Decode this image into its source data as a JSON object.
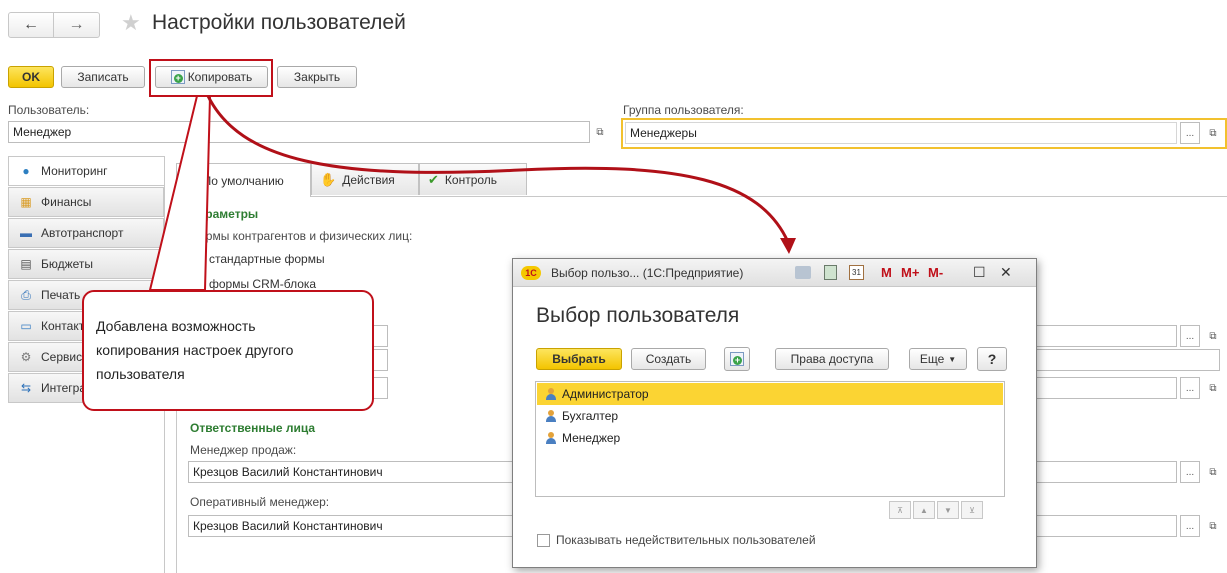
{
  "header": {
    "title": "Настройки пользователей",
    "back_icon": "←",
    "forward_icon": "→",
    "star_icon": "★"
  },
  "toolbar": {
    "ok_label": "OK",
    "save_label": "Записать",
    "copy_label": "Копировать",
    "close_label": "Закрыть"
  },
  "form": {
    "user_label": "Пользователь:",
    "user_value": "Менеджер",
    "group_label": "Группа пользователя:",
    "group_value": "Менеджеры",
    "ellipsis": "...",
    "open_glyph": "⧉"
  },
  "sidebar": {
    "items": [
      {
        "label": "Мониторинг",
        "icon": "globe-icon",
        "glyph": "●"
      },
      {
        "label": "Финансы",
        "icon": "finance-icon",
        "glyph": "▦"
      },
      {
        "label": "Автотранспорт",
        "icon": "truck-icon",
        "glyph": "▬"
      },
      {
        "label": "Бюджеты",
        "icon": "budget-icon",
        "glyph": "▤"
      },
      {
        "label": "Печать",
        "icon": "printer-icon",
        "glyph": "⎙"
      },
      {
        "label": "Контакты",
        "icon": "contacts-icon",
        "glyph": "▭"
      },
      {
        "label": "Сервис",
        "icon": "gear-icon",
        "glyph": "⚙"
      },
      {
        "label": "Интеграция",
        "icon": "integration-icon",
        "glyph": "⇆"
      }
    ]
  },
  "tabs": [
    {
      "label": "По умолчанию",
      "icon": "star-icon",
      "glyph": "★",
      "color": "#f0b400"
    },
    {
      "label": "Действия",
      "icon": "hand-icon",
      "glyph": "✋",
      "color": "#e0a050"
    },
    {
      "label": "Контроль",
      "icon": "check-icon",
      "glyph": "✔",
      "color": "#3a9a2a"
    }
  ],
  "parameters": {
    "title": "Параметры",
    "forms_label": "Формы контрагентов и физических лиц:",
    "option_standard": "стандартные формы",
    "option_crm": "формы CRM-блока"
  },
  "responsible": {
    "title": "Ответственные лица",
    "sales_manager_label": "Менеджер продаж:",
    "sales_manager_value": "Крезцов Василий Константинович",
    "op_manager_label": "Оперативный менеджер:",
    "op_manager_value": "Крезцов Василий Константинович"
  },
  "callout": {
    "text": "Добавлена возможность копирования настроек другого пользователя",
    "border_color": "#c0101a"
  },
  "dialog": {
    "window_title": "Выбор пользо... (1С:Предприятие)",
    "app_logo": "1С",
    "heading": "Выбор пользователя",
    "select_label": "Выбрать",
    "create_label": "Создать",
    "rights_label": "Права доступа",
    "more_label": "Еще",
    "help_label": "?",
    "m_label": "M",
    "mplus_label": "M+",
    "mminus_label": "M-",
    "close_glyph": "✕",
    "maximize_glyph": "☐",
    "users": [
      {
        "name": "Администратор",
        "selected": true
      },
      {
        "name": "Бухгалтер",
        "selected": false
      },
      {
        "name": "Менеджер",
        "selected": false
      }
    ],
    "show_inactive_label": "Показывать недействительных пользователей"
  },
  "colors": {
    "accent_yellow": "#f5c800",
    "highlight_border": "#f2c12e",
    "selection": "#fbd433",
    "annotation_red": "#c0101a",
    "section_green": "#2e7d32"
  }
}
